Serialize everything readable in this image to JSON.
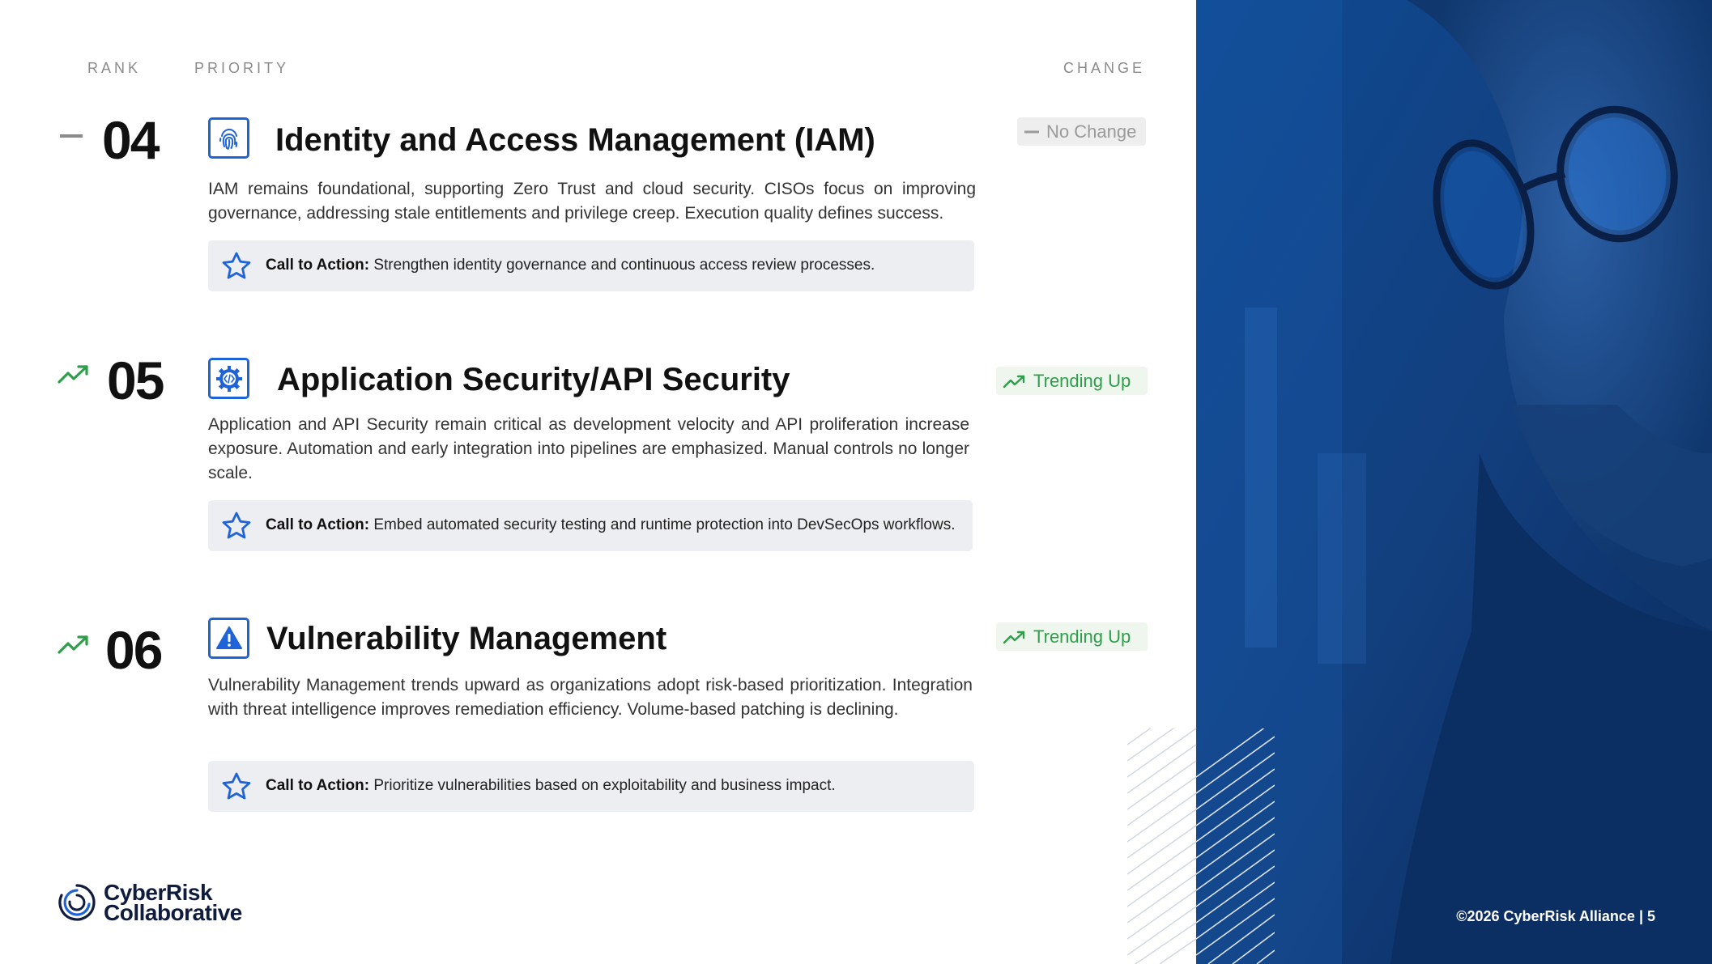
{
  "columns": {
    "rank": "RANK",
    "priority": "PRIORITY",
    "change": "CHANGE"
  },
  "entries": [
    {
      "rank": "04",
      "rank_trend_icon": "dash-icon",
      "category_icon": "fingerprint-icon",
      "title": "Identity and Access Management (IAM)",
      "description": "IAM remains foundational, supporting Zero Trust and cloud security. CISOs focus on improving governance, addressing stale entitlements and privilege creep. Execution quality defines success.",
      "cta_label": "Call to Action:",
      "cta_text": " Strengthen identity governance and continuous access review processes.",
      "change": "No Change"
    },
    {
      "rank": "05",
      "rank_trend_icon": "trending-up-icon",
      "category_icon": "code-gear-icon",
      "title": "Application Security/API Security",
      "description": "Application and API Security remain critical as development velocity and API proliferation increase exposure. Automation and early integration into pipelines are emphasized. Manual controls no longer scale.",
      "cta_label": "Call to Action:",
      "cta_text": " Embed automated security testing and runtime protection into DevSecOps workflows.",
      "change": "Trending Up"
    },
    {
      "rank": "06",
      "rank_trend_icon": "trending-up-icon",
      "category_icon": "warning-triangle-icon",
      "title": "Vulnerability Management",
      "description": "Vulnerability Management trends upward as organizations adopt risk-based prioritization. Integration with threat intelligence improves remediation efficiency. Volume-based patching is declining.",
      "cta_label": "Call to Action:",
      "cta_text": " Prioritize vulnerabilities based on exploitability and business impact.",
      "change": "Trending Up"
    }
  ],
  "logo": {
    "line1": "CyberRisk",
    "line2": "Collaborative"
  },
  "footer": "©2026 CyberRisk Alliance  |  5",
  "colors": {
    "accent": "#1f63d8",
    "trend_up": "#2e9e4a",
    "neutral": "#9a9a9a",
    "photo_blue": "#123f7e"
  }
}
